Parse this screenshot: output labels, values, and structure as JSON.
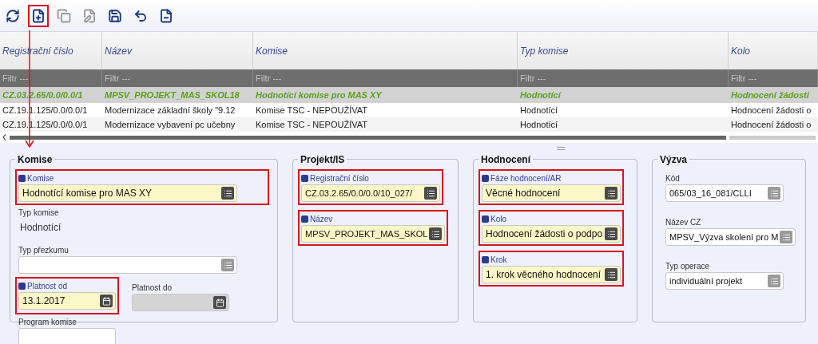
{
  "toolbar": [
    {
      "kind": "refresh",
      "disabled": false,
      "highlighted": false
    },
    {
      "kind": "new",
      "disabled": false,
      "highlighted": true
    },
    {
      "kind": "copy",
      "disabled": true,
      "highlighted": false
    },
    {
      "kind": "edit",
      "disabled": true,
      "highlighted": false
    },
    {
      "kind": "save",
      "disabled": false,
      "highlighted": false
    },
    {
      "kind": "undo",
      "disabled": false,
      "highlighted": false
    },
    {
      "kind": "remove",
      "disabled": false,
      "highlighted": false
    }
  ],
  "table": {
    "columns": [
      "Registrační číslo",
      "Název",
      "Komise",
      "Typ komise",
      "Kolo"
    ],
    "filters": [
      "Filtr ---",
      "Filtr ---",
      "Filtr ---",
      "Filtr ---",
      "Filtr ---"
    ],
    "rows": [
      {
        "selected": true,
        "cells": [
          "CZ.03.2.65/0.0/0.0/1",
          "MPSV_PROJEKT_MAS_SKOL18",
          "Hodnotící komise pro MAS XY",
          "Hodnotící",
          "Hodnocení žádosti"
        ]
      },
      {
        "selected": false,
        "cells": [
          "CZ.19.1.125/0.0/0.0/1",
          "Modernizace základní školy \"9.12",
          "Komise TSC - NEPOUŽÍVAT",
          "Hodnotící",
          "Hodnocení žádosti o"
        ]
      },
      {
        "selected": false,
        "cells": [
          "CZ.19.1.125/0.0/0.0/1",
          "Modernizace vybavení pc učebny",
          "Komise TSC - NEPOUŽÍVAT",
          "Hodnotící",
          "Hodnocení žádosti o"
        ]
      }
    ]
  },
  "groups": [
    {
      "title": "Komise",
      "fields": [
        {
          "kind": "select",
          "label": "Komise",
          "value": "Hodnotící komise pro MAS XY",
          "required": true,
          "highlighted": true,
          "disabled": false
        },
        {
          "kind": "readonly",
          "label": "Typ komise",
          "value": "Hodnotící"
        },
        {
          "kind": "select",
          "label": "Typ přezkumu",
          "required": false,
          "highlighted": false,
          "disabled": false
        },
        {
          "kind": "date",
          "label": "Platnost od",
          "value": "13.1.2017",
          "required": true,
          "highlighted": true,
          "disabled": false
        },
        {
          "kind": "date",
          "label": "Platnost do",
          "required": false,
          "highlighted": false,
          "disabled": true
        },
        {
          "kind": "text",
          "label": "Program komise",
          "required": false,
          "highlighted": false,
          "disabled": false
        }
      ]
    },
    {
      "title": "Projekt/IS",
      "fields": [
        {
          "kind": "select",
          "label": "Registrační číslo",
          "value": "CZ.03.2.65/0.0/0.0/10_027/",
          "required": true,
          "highlighted": true,
          "disabled": false
        },
        {
          "kind": "select",
          "label": "Název",
          "value": "MPSV_PROJEKT_MAS_SKOL",
          "required": true,
          "highlighted": true,
          "disabled": false
        }
      ]
    },
    {
      "title": "Hodnocení",
      "fields": [
        {
          "kind": "select",
          "label": "Fáze hodnocení/AR",
          "value": "Věcné hodnocení",
          "required": true,
          "highlighted": true,
          "disabled": false
        },
        {
          "kind": "select",
          "label": "Kolo",
          "value": "Hodnocení žádosti o podpo",
          "required": true,
          "highlighted": true,
          "disabled": false
        },
        {
          "kind": "select",
          "label": "Krok",
          "value": "1. krok věcného hodnocení",
          "required": true,
          "highlighted": true,
          "disabled": false
        }
      ]
    },
    {
      "title": "Výzva",
      "fields": [
        {
          "kind": "select",
          "label": "Kód",
          "value": "065/03_16_081/CLLI",
          "required": false,
          "highlighted": false,
          "disabled": false
        },
        {
          "kind": "select",
          "label": "Název CZ",
          "value": "MPSV_Výzva skolení pro M",
          "required": false,
          "highlighted": false,
          "disabled": false
        },
        {
          "kind": "select",
          "label": "Typ operace",
          "value": "individuální projekt",
          "required": false,
          "highlighted": false,
          "disabled": false
        }
      ]
    }
  ]
}
